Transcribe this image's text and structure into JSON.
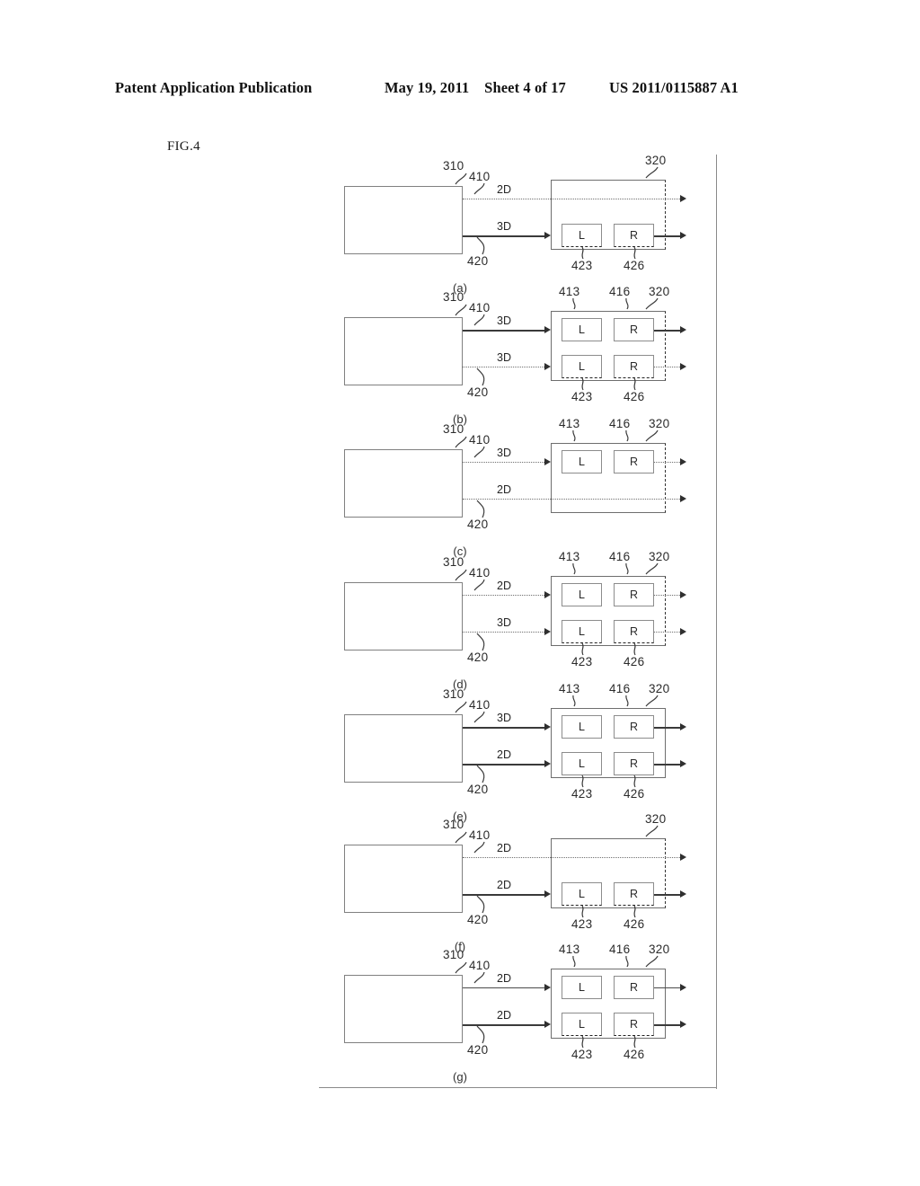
{
  "header": {
    "publication": "Patent Application Publication",
    "date": "May 19, 2011",
    "sheet": "Sheet 4 of 17",
    "docnum": "US 2011/0115887 A1"
  },
  "figure": {
    "label": "FIG.4",
    "refs": {
      "source": "310",
      "sink": "320",
      "line_top": "410",
      "line_bottom": "420",
      "top_left_cell": "413",
      "top_right_cell": "416",
      "bottom_left_cell": "423",
      "bottom_right_cell": "426"
    },
    "cells": {
      "left": "L",
      "right": "R"
    },
    "colors": {
      "line_solid": "#3a3a3a",
      "line_dotted": "#6f6f6f",
      "box_border": "#808080",
      "frame": "#8a8a8a",
      "text": "#262626"
    }
  },
  "panels": [
    {
      "id": "a",
      "caption": "(a)",
      "top": {
        "mode": "2D",
        "style": "dotted",
        "ref": "410",
        "passthrough": true
      },
      "bottom": {
        "mode": "3D",
        "style": "solid",
        "ref": "420",
        "passthrough": false
      },
      "cells_rows": 1,
      "cell_row_position": "bottom",
      "show_top_refs": false,
      "show_bottom_refs": true
    },
    {
      "id": "b",
      "caption": "(b)",
      "top": {
        "mode": "3D",
        "style": "solid",
        "ref": "410",
        "passthrough": false
      },
      "bottom": {
        "mode": "3D",
        "style": "dotted",
        "ref": "420",
        "passthrough": false
      },
      "cells_rows": 2,
      "cell_row_position": "both",
      "show_top_refs": true,
      "show_bottom_refs": true
    },
    {
      "id": "c",
      "caption": "(c)",
      "top": {
        "mode": "3D",
        "style": "dotted",
        "ref": "410",
        "passthrough": false
      },
      "bottom": {
        "mode": "2D",
        "style": "dotted",
        "ref": "420",
        "passthrough": true
      },
      "cells_rows": 1,
      "cell_row_position": "top",
      "show_top_refs": true,
      "show_bottom_refs": false
    },
    {
      "id": "d",
      "caption": "(d)",
      "top": {
        "mode": "2D",
        "style": "dotted",
        "ref": "410",
        "passthrough": false
      },
      "bottom": {
        "mode": "3D",
        "style": "dotted",
        "ref": "420",
        "passthrough": false
      },
      "cells_rows": 2,
      "cell_row_position": "both",
      "show_top_refs": true,
      "show_bottom_refs": true
    },
    {
      "id": "e",
      "caption": "(e)",
      "top": {
        "mode": "3D",
        "style": "solid",
        "ref": "410",
        "passthrough": false
      },
      "bottom": {
        "mode": "2D",
        "style": "solid",
        "ref": "420",
        "passthrough": false
      },
      "cells_rows": 2,
      "cell_row_position": "both",
      "show_top_refs": true,
      "show_bottom_refs": true
    },
    {
      "id": "f",
      "caption": "(f)",
      "top": {
        "mode": "2D",
        "style": "dotted",
        "ref": "410",
        "passthrough": true
      },
      "bottom": {
        "mode": "2D",
        "style": "solid",
        "ref": "420",
        "passthrough": false
      },
      "cells_rows": 1,
      "cell_row_position": "bottom",
      "show_top_refs": false,
      "show_bottom_refs": true
    },
    {
      "id": "g",
      "caption": "(g)",
      "top": {
        "mode": "2D",
        "style": "solidthin",
        "ref": "410",
        "passthrough": false
      },
      "bottom": {
        "mode": "2D",
        "style": "solid",
        "ref": "420",
        "passthrough": false
      },
      "cells_rows": 2,
      "cell_row_position": "both",
      "show_top_refs": true,
      "show_bottom_refs": true
    }
  ]
}
